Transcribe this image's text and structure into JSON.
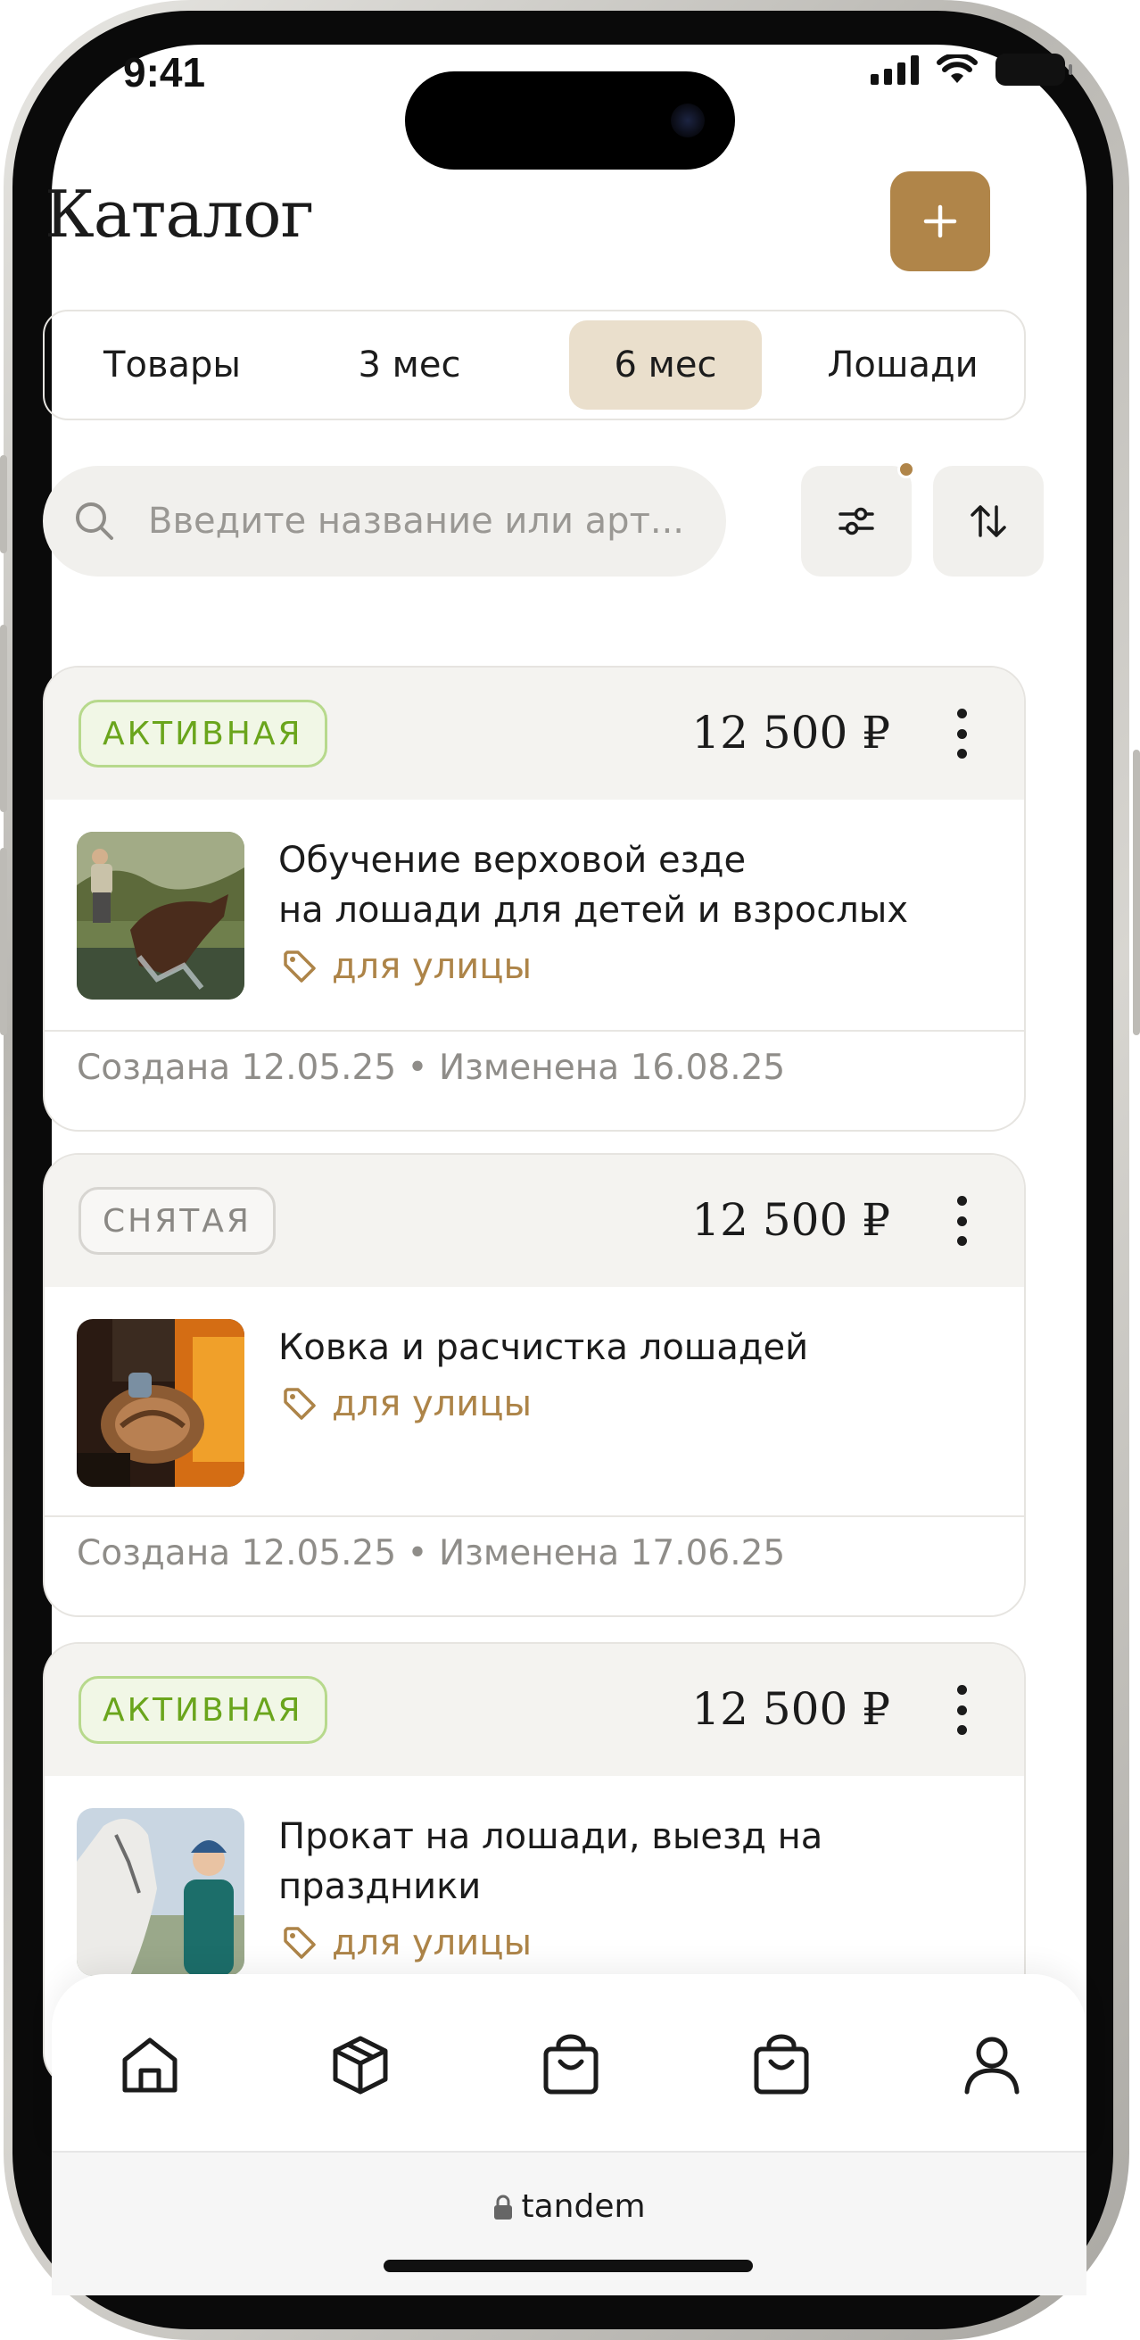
{
  "status_bar": {
    "time": "9:41"
  },
  "header": {
    "title": "Каталог",
    "add_icon": "plus-icon"
  },
  "tabs": [
    {
      "label": "Товары",
      "active": false
    },
    {
      "label": "3 мес",
      "active": false
    },
    {
      "label": "6 мес",
      "active": true
    },
    {
      "label": "Лошади",
      "active": false
    }
  ],
  "search": {
    "placeholder": "Введите название или арт...",
    "value": ""
  },
  "toolbar": {
    "filter_icon": "sliders-icon",
    "filter_has_indicator": true,
    "sort_icon": "sort-arrows-icon"
  },
  "items": [
    {
      "status": "АКТИВНАЯ",
      "status_kind": "active",
      "price": "12 500 ₽",
      "title_line1": "Обучение верховой езде",
      "title_line2": "на лошади для детей и взрослых",
      "tag": "для улицы",
      "meta": "Создана 12.05.25 • Изменена 16.08.25"
    },
    {
      "status": "СНЯТАЯ",
      "status_kind": "removed",
      "price": "12 500 ₽",
      "title_line1": "Ковка и расчистка лошадей",
      "title_line2": "",
      "tag": "для улицы",
      "meta": "Создана 12.05.25 • Изменена 17.06.25"
    },
    {
      "status": "АКТИВНАЯ",
      "status_kind": "active",
      "price": "12 500 ₽",
      "title_line1": "Прокат на лошади, выезд на",
      "title_line2": "праздники",
      "tag": "для улицы",
      "meta": ""
    }
  ],
  "bottom_nav": [
    {
      "icon": "home-icon"
    },
    {
      "icon": "box-icon"
    },
    {
      "icon": "bag-icon"
    },
    {
      "icon": "bag-icon"
    },
    {
      "icon": "profile-icon"
    }
  ],
  "browser": {
    "url": "tandem"
  },
  "colors": {
    "accent": "#b08549",
    "active_badge": "#6aa51c",
    "tab_active_bg": "#eadfcc"
  }
}
